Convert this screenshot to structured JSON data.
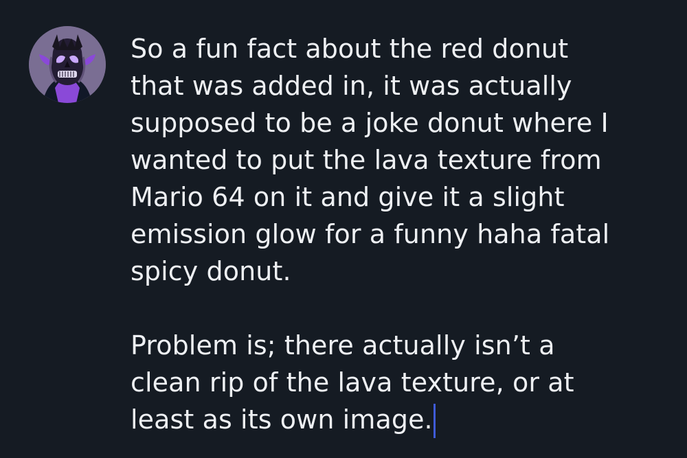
{
  "message": {
    "paragraphs": [
      {
        "lines": [
          "So a fun fact about the red donut",
          "that was added in, it was actually",
          "supposed to be a joke donut where I",
          "wanted to put the lava texture from",
          "Mario 64 on it and give it a slight",
          "emission glow for a funny haha fatal",
          "spicy donut."
        ]
      },
      {
        "lines": [
          "Problem is; there actually isn’t a",
          "clean rip of the lava texture, or at",
          "least as its own image."
        ]
      }
    ]
  },
  "avatar": {
    "icon": "skull-character-avatar",
    "colors": {
      "background": "#7a6e93",
      "skin": "#8a49d8",
      "eyes": "#c9a7ff",
      "outfit": "#111828"
    }
  },
  "caret": {
    "color": "#3f5bd8"
  }
}
